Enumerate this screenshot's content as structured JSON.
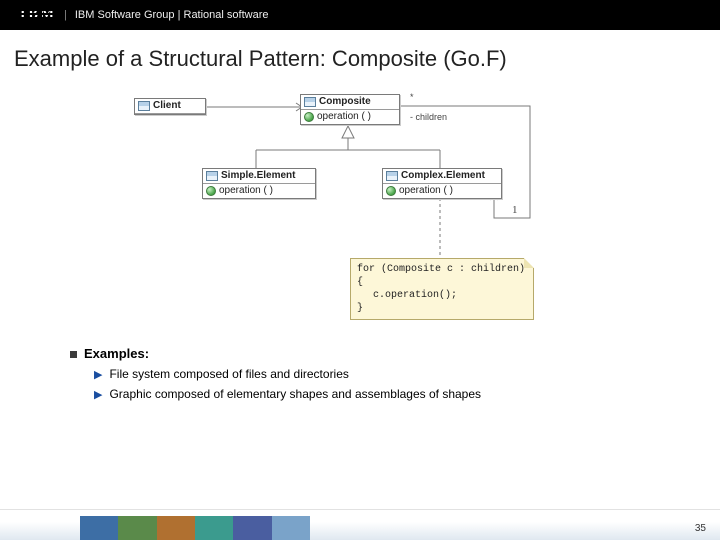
{
  "header": {
    "logo_text": "IBM",
    "group_text": "IBM Software Group | Rational software"
  },
  "title": "Example of a Structural Pattern: Composite (Go.F)",
  "diagram": {
    "client": {
      "name": "Client"
    },
    "composite": {
      "name": "Composite",
      "op": "operation ( )"
    },
    "simple": {
      "name": "Simple.Element",
      "op": "operation ( )"
    },
    "complex": {
      "name": "Complex.Element",
      "op": "operation ( )"
    },
    "assoc_star": "*",
    "assoc_role": "- children",
    "assoc_one": "1",
    "note_l1": "for (Composite c : children) {",
    "note_l2": "c.operation();",
    "note_l3": "}"
  },
  "examples": {
    "heading": "Examples:",
    "item1": "File system composed of files and directories",
    "item2": "Graphic composed of elementary shapes and assemblages of shapes"
  },
  "page_number": "35",
  "footer_colors": [
    "#3d6ea5",
    "#5a8a4a",
    "#b07030",
    "#3b9b8e",
    "#4a5ea0",
    "#7aa3c9"
  ]
}
